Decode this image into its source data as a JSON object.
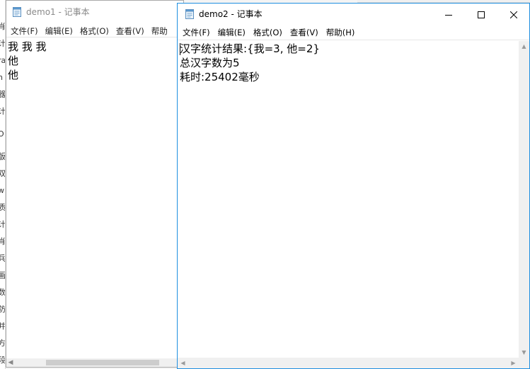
{
  "background": {
    "left_strip_chars": [
      "肖",
      "计",
      "ra",
      "h",
      "器",
      "计",
      "O",
      "版",
      "双",
      "w",
      "质",
      "计",
      "肖",
      "兵",
      "画",
      "数",
      "防",
      "并",
      "方",
      "段"
    ]
  },
  "window1": {
    "title": "demo1 - 记事本",
    "menu": [
      "文件(F)",
      "编辑(E)",
      "格式(O)",
      "查看(V)",
      "帮助"
    ],
    "lines": [
      "我 我 我",
      "他",
      "他"
    ]
  },
  "window2": {
    "title": "demo2 - 记事本",
    "menu": [
      "文件(F)",
      "编辑(E)",
      "格式(O)",
      "查看(V)",
      "帮助(H)"
    ],
    "lines": [
      "汉字统计结果:{我=3, 他=2}",
      "总汉字数为5",
      "耗时:25402毫秒"
    ],
    "controls": {
      "minimize": "minimize-icon",
      "maximize": "maximize-icon",
      "close": "close-icon"
    }
  },
  "colors": {
    "active_border": "#1f8fe0",
    "inactive_title": "#8a8a8a",
    "scrollbar_bg": "#f0f0f0"
  }
}
